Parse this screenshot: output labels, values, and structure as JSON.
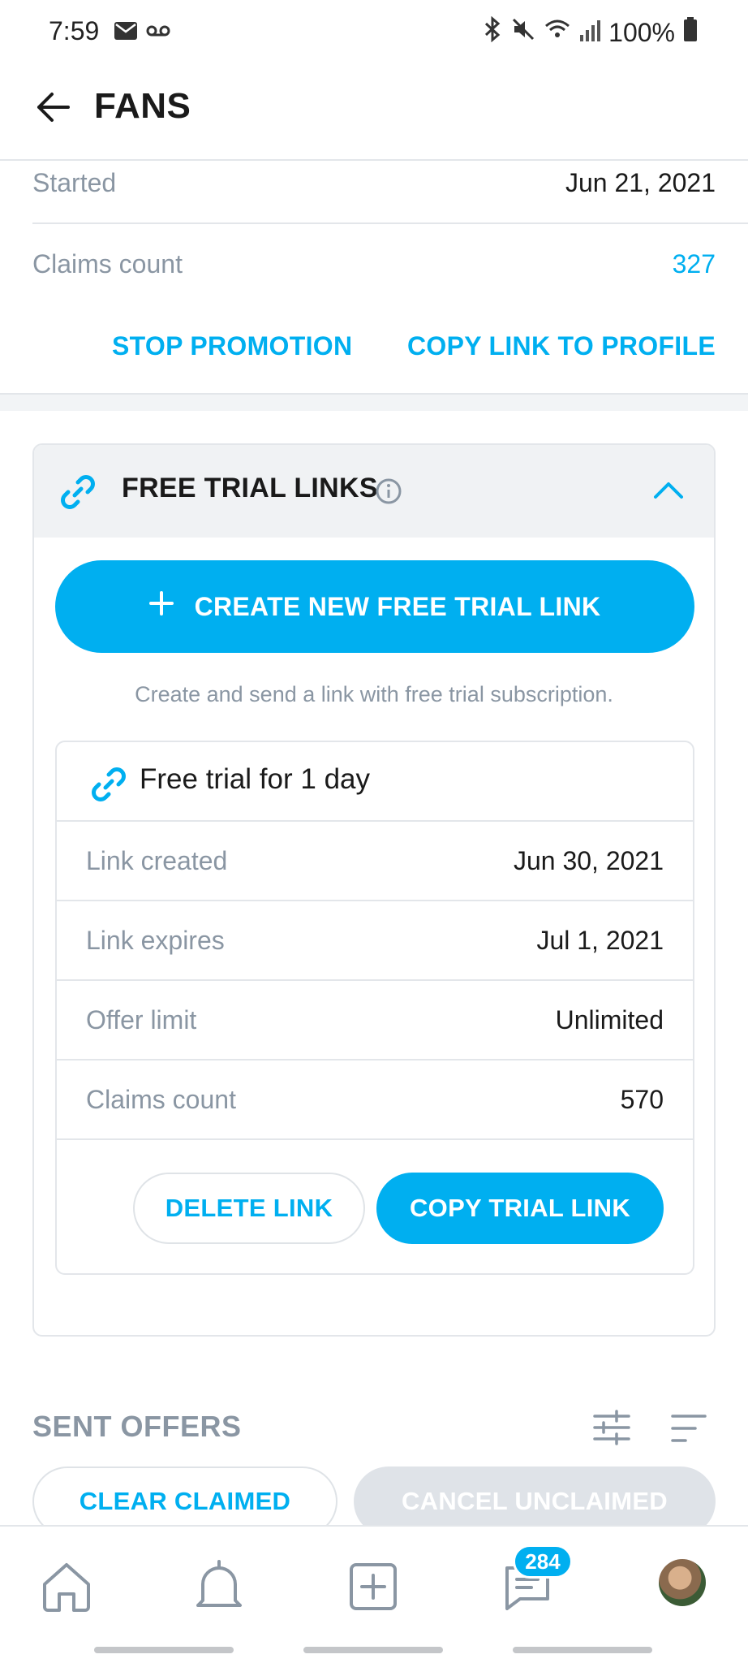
{
  "status_bar": {
    "time": "7:59",
    "battery": "100%",
    "icons": [
      "mail-icon",
      "voicemail-icon",
      "bluetooth-icon",
      "mute-icon",
      "wifi-icon",
      "signal-icon",
      "battery-icon"
    ]
  },
  "header": {
    "title": "FANS",
    "back_icon": "arrow-left-icon"
  },
  "promotion": {
    "rows": [
      {
        "label": "Started",
        "value": "Jun 21, 2021"
      },
      {
        "label": "Claims count",
        "value": "327"
      }
    ],
    "stop_label": "STOP PROMOTION",
    "copy_label": "COPY LINK TO PROFILE"
  },
  "free_trial": {
    "title": "FREE TRIAL LINKS",
    "create_label": "CREATE NEW FREE TRIAL LINK",
    "hint": "Create and send a link with free trial subscription.",
    "link": {
      "title": "Free trial for 1 day",
      "rows": [
        {
          "label": "Link created",
          "value": "Jun 30, 2021"
        },
        {
          "label": "Link expires",
          "value": "Jul 1, 2021"
        },
        {
          "label": "Offer limit",
          "value": "Unlimited"
        },
        {
          "label": "Claims count",
          "value": "570"
        }
      ],
      "delete_label": "DELETE LINK",
      "copy_label": "COPY TRIAL LINK"
    }
  },
  "sent_offers": {
    "title": "SENT OFFERS",
    "clear_label": "CLEAR CLAIMED",
    "cancel_label": "CANCEL UNCLAIMED"
  },
  "bottom_nav": {
    "items": [
      "home-icon",
      "bell-icon",
      "add-post-icon",
      "messages-icon",
      "profile-avatar"
    ],
    "messages_badge": "284"
  },
  "colors": {
    "accent": "#00aff0",
    "muted": "#8a96a3",
    "divider": "#e3e6ea"
  }
}
